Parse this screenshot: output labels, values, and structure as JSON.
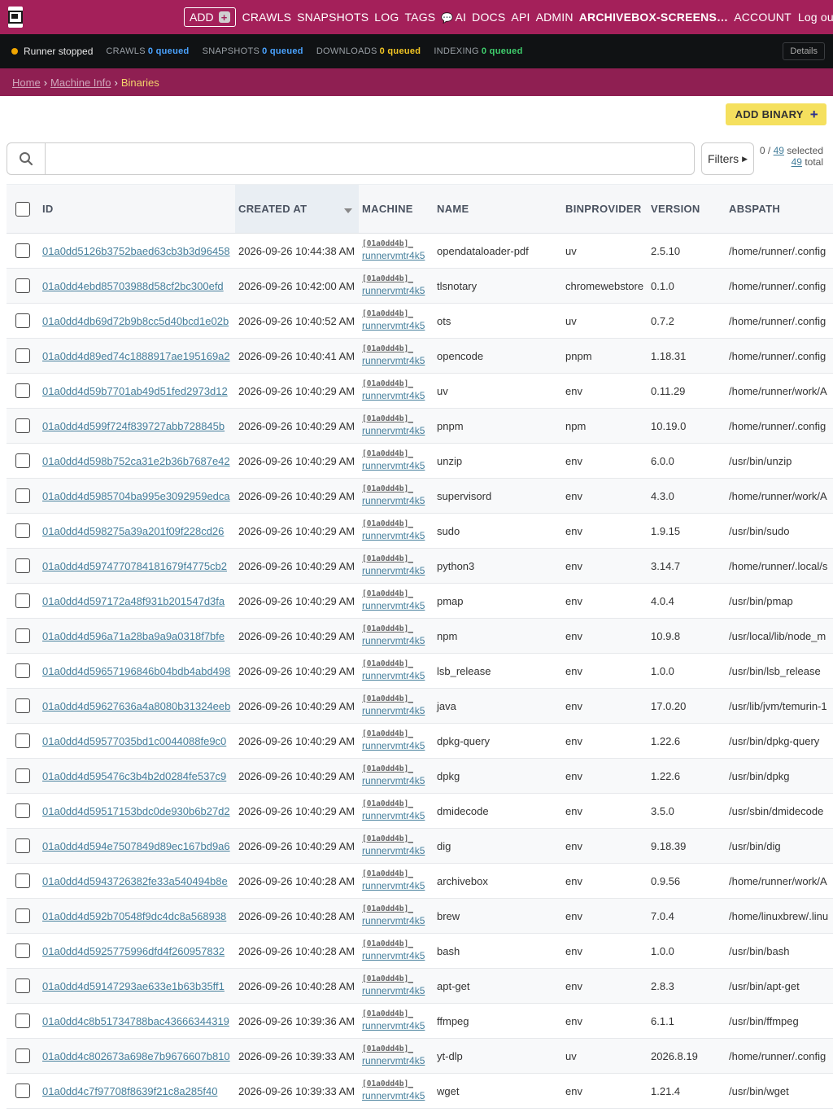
{
  "nav": {
    "add_label": "ADD",
    "add_plus": "+",
    "links": [
      "CRAWLS",
      "SNAPSHOTS",
      "LOG",
      "TAGS"
    ],
    "ai_label": "AI",
    "links2": [
      "DOCS",
      "API",
      "ADMIN"
    ],
    "instance_name": "ARCHIVEBOX-SCREENS…",
    "account_label": "ACCOUNT",
    "logout_label": "Log out"
  },
  "status": {
    "runner": "Runner stopped",
    "crawls_label": "CRAWLS",
    "crawls_q": "0 queued",
    "snapshots_label": "SNAPSHOTS",
    "snapshots_q": "0 queued",
    "downloads_label": "DOWNLOADS",
    "downloads_q": "0 queued",
    "indexing_label": "INDEXING",
    "indexing_q": "0 queued",
    "details_label": "Details",
    "colors": {
      "runner_dot": "#f0a500",
      "crawls": "#4aa3ff",
      "downloads": "#f3c623",
      "indexing": "#3fcf6d"
    }
  },
  "breadcrumb": {
    "home": "Home",
    "machine_info": "Machine Info",
    "sep": "›",
    "current": "Binaries"
  },
  "toolbar": {
    "add_binary_label": "ADD BINARY",
    "search_placeholder": "",
    "filters_label": "Filters",
    "selected_count": "0",
    "selected_total": "49",
    "selected_suffix": "selected",
    "total_count": "49",
    "total_suffix": "total"
  },
  "table": {
    "columns": [
      "ID",
      "CREATED AT",
      "MACHINE",
      "NAME",
      "BINPROVIDER",
      "VERSION",
      "ABSPATH"
    ],
    "machine_code": "[01a0dd4b]_",
    "machine_host": "runnervmtr4k5",
    "rows": [
      {
        "id": "01a0dd5126b3752baed63cb3b3d96458",
        "created": "2026-09-26 10:44:38 AM",
        "name": "opendataloader-pdf",
        "provider": "uv",
        "version": "2.5.10",
        "abspath": "/home/runner/.config"
      },
      {
        "id": "01a0dd4ebd85703988d58cf2bc300efd",
        "created": "2026-09-26 10:42:00 AM",
        "name": "tlsnotary",
        "provider": "chromewebstore",
        "version": "0.1.0",
        "abspath": "/home/runner/.config"
      },
      {
        "id": "01a0dd4db69d72b9b8cc5d40bcd1e02b",
        "created": "2026-09-26 10:40:52 AM",
        "name": "ots",
        "provider": "uv",
        "version": "0.7.2",
        "abspath": "/home/runner/.config"
      },
      {
        "id": "01a0dd4d89ed74c1888917ae195169a2",
        "created": "2026-09-26 10:40:41 AM",
        "name": "opencode",
        "provider": "pnpm",
        "version": "1.18.31",
        "abspath": "/home/runner/.config"
      },
      {
        "id": "01a0dd4d59b7701ab49d51fed2973d12",
        "created": "2026-09-26 10:40:29 AM",
        "name": "uv",
        "provider": "env",
        "version": "0.11.29",
        "abspath": "/home/runner/work/A"
      },
      {
        "id": "01a0dd4d599f724f839727abb728845b",
        "created": "2026-09-26 10:40:29 AM",
        "name": "pnpm",
        "provider": "npm",
        "version": "10.19.0",
        "abspath": "/home/runner/.config"
      },
      {
        "id": "01a0dd4d598b752ca31e2b36b7687e42",
        "created": "2026-09-26 10:40:29 AM",
        "name": "unzip",
        "provider": "env",
        "version": "6.0.0",
        "abspath": "/usr/bin/unzip"
      },
      {
        "id": "01a0dd4d5985704ba995e3092959edca",
        "created": "2026-09-26 10:40:29 AM",
        "name": "supervisord",
        "provider": "env",
        "version": "4.3.0",
        "abspath": "/home/runner/work/A"
      },
      {
        "id": "01a0dd4d598275a39a201f09f228cd26",
        "created": "2026-09-26 10:40:29 AM",
        "name": "sudo",
        "provider": "env",
        "version": "1.9.15",
        "abspath": "/usr/bin/sudo"
      },
      {
        "id": "01a0dd4d5974770784181679f4775cb2",
        "created": "2026-09-26 10:40:29 AM",
        "name": "python3",
        "provider": "env",
        "version": "3.14.7",
        "abspath": "/home/runner/.local/s"
      },
      {
        "id": "01a0dd4d597172a48f931b201547d3fa",
        "created": "2026-09-26 10:40:29 AM",
        "name": "pmap",
        "provider": "env",
        "version": "4.0.4",
        "abspath": "/usr/bin/pmap"
      },
      {
        "id": "01a0dd4d596a71a28ba9a9a0318f7bfe",
        "created": "2026-09-26 10:40:29 AM",
        "name": "npm",
        "provider": "env",
        "version": "10.9.8",
        "abspath": "/usr/local/lib/node_m"
      },
      {
        "id": "01a0dd4d59657196846b04bdb4abd498",
        "created": "2026-09-26 10:40:29 AM",
        "name": "lsb_release",
        "provider": "env",
        "version": "1.0.0",
        "abspath": "/usr/bin/lsb_release"
      },
      {
        "id": "01a0dd4d59627636a4a8080b31324eeb",
        "created": "2026-09-26 10:40:29 AM",
        "name": "java",
        "provider": "env",
        "version": "17.0.20",
        "abspath": "/usr/lib/jvm/temurin-1"
      },
      {
        "id": "01a0dd4d59577035bd1c0044088fe9c0",
        "created": "2026-09-26 10:40:29 AM",
        "name": "dpkg-query",
        "provider": "env",
        "version": "1.22.6",
        "abspath": "/usr/bin/dpkg-query"
      },
      {
        "id": "01a0dd4d595476c3b4b2d0284fe537c9",
        "created": "2026-09-26 10:40:29 AM",
        "name": "dpkg",
        "provider": "env",
        "version": "1.22.6",
        "abspath": "/usr/bin/dpkg"
      },
      {
        "id": "01a0dd4d59517153bdc0de930b6b27d2",
        "created": "2026-09-26 10:40:29 AM",
        "name": "dmidecode",
        "provider": "env",
        "version": "3.5.0",
        "abspath": "/usr/sbin/dmidecode"
      },
      {
        "id": "01a0dd4d594e7507849d89ec167bd9a6",
        "created": "2026-09-26 10:40:29 AM",
        "name": "dig",
        "provider": "env",
        "version": "9.18.39",
        "abspath": "/usr/bin/dig"
      },
      {
        "id": "01a0dd4d5943726382fe33a540494b8e",
        "created": "2026-09-26 10:40:28 AM",
        "name": "archivebox",
        "provider": "env",
        "version": "0.9.56",
        "abspath": "/home/runner/work/A"
      },
      {
        "id": "01a0dd4d592b70548f9dc4dc8a568938",
        "created": "2026-09-26 10:40:28 AM",
        "name": "brew",
        "provider": "env",
        "version": "7.0.4",
        "abspath": "/home/linuxbrew/.linu"
      },
      {
        "id": "01a0dd4d5925775996dfd4f260957832",
        "created": "2026-09-26 10:40:28 AM",
        "name": "bash",
        "provider": "env",
        "version": "1.0.0",
        "abspath": "/usr/bin/bash"
      },
      {
        "id": "01a0dd4d59147293ae633e1b63b35ff1",
        "created": "2026-09-26 10:40:28 AM",
        "name": "apt-get",
        "provider": "env",
        "version": "2.8.3",
        "abspath": "/usr/bin/apt-get"
      },
      {
        "id": "01a0dd4c8b51734788bac43666344319",
        "created": "2026-09-26 10:39:36 AM",
        "name": "ffmpeg",
        "provider": "env",
        "version": "6.1.1",
        "abspath": "/usr/bin/ffmpeg"
      },
      {
        "id": "01a0dd4c802673a698e7b9676607b810",
        "created": "2026-09-26 10:39:33 AM",
        "name": "yt-dlp",
        "provider": "uv",
        "version": "2026.8.19",
        "abspath": "/home/runner/.config"
      },
      {
        "id": "01a0dd4c7f97708f8639f21c8a285f40",
        "created": "2026-09-26 10:39:33 AM",
        "name": "wget",
        "provider": "env",
        "version": "1.21.4",
        "abspath": "/usr/bin/wget"
      }
    ]
  }
}
